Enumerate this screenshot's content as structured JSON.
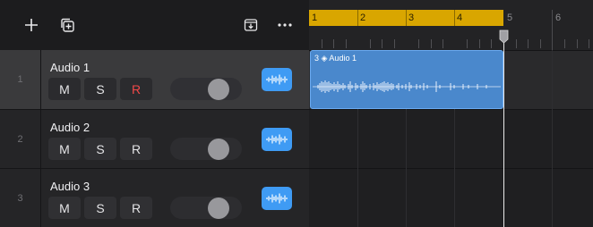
{
  "toolbar": {
    "add_icon": "plus-icon",
    "duplicate_icon": "duplicate-icon",
    "import_icon": "import-icon",
    "more_icon": "ellipsis-icon"
  },
  "tracks": [
    {
      "number": "1",
      "name": "Audio 1",
      "mute": "M",
      "solo": "S",
      "record": "R",
      "record_armed": true,
      "selected": true,
      "volume": 0.65
    },
    {
      "number": "2",
      "name": "Audio 2",
      "mute": "M",
      "solo": "S",
      "record": "R",
      "record_armed": false,
      "selected": false,
      "volume": 0.65
    },
    {
      "number": "3",
      "name": "Audio 3",
      "mute": "M",
      "solo": "S",
      "record": "R",
      "record_armed": false,
      "selected": false,
      "volume": 0.65
    }
  ],
  "ruler": {
    "bars": [
      "1",
      "2",
      "3",
      "4",
      "5",
      "6"
    ],
    "cycle_color": "#d9a600"
  },
  "region": {
    "label": "3 ◈ Audio 1",
    "color": "#4a88cc"
  },
  "colors": {
    "accent": "#3f9bf4",
    "record": "#f04848"
  }
}
